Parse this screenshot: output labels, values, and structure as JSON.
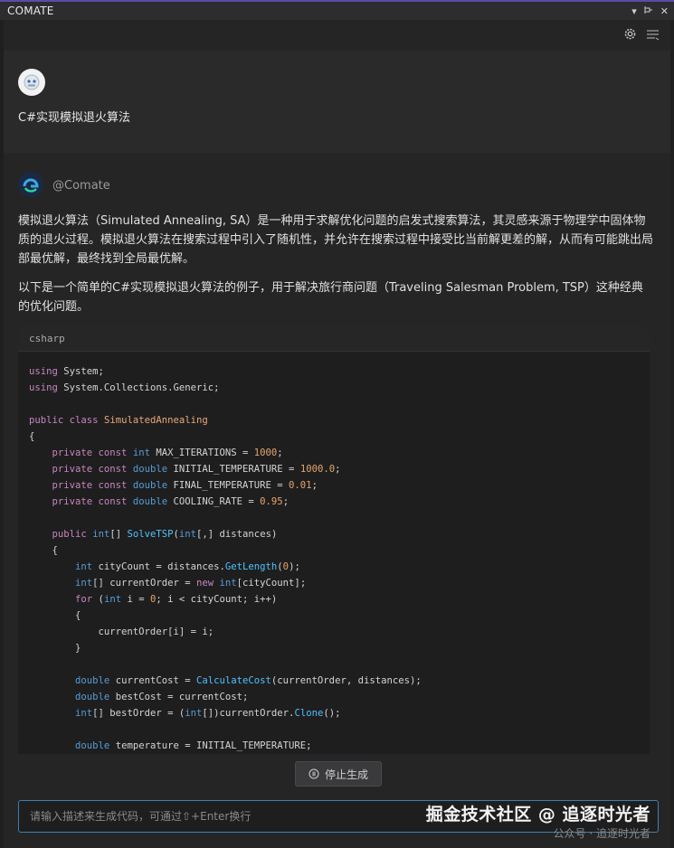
{
  "window": {
    "title": "COMATE"
  },
  "user": {
    "message": "C#实现模拟退火算法"
  },
  "bot": {
    "name": "@Comate",
    "para1": "模拟退火算法（Simulated Annealing, SA）是一种用于求解优化问题的启发式搜索算法，其灵感来源于物理学中固体物质的退火过程。模拟退火算法在搜索过程中引入了随机性，并允许在搜索过程中接受比当前解更差的解，从而有可能跳出局部最优解，最终找到全局最优解。",
    "para2": "以下是一个简单的C#实现模拟退火算法的例子，用于解决旅行商问题（Traveling Salesman Problem, TSP）这种经典的优化问题。",
    "code_lang": "csharp"
  },
  "controls": {
    "stop_label": "停止生成",
    "input_placeholder": "请输入描述来生成代码，可通过⇧+Enter换行"
  },
  "watermark": {
    "line1": "掘金技术社区 @ 追逐时光者",
    "line2": "公众号 · 追逐时光者"
  },
  "icons": {
    "titlebar": [
      "dropdown-icon",
      "pin-icon",
      "close-icon"
    ],
    "toolbar": [
      "gear-icon",
      "history-icon"
    ]
  }
}
